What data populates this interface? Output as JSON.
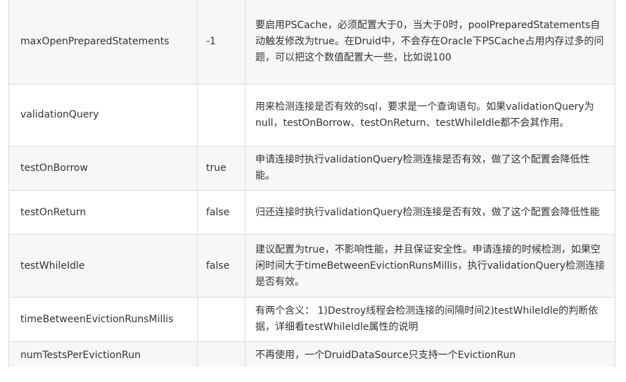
{
  "rows": [
    {
      "name": "maxOpenPreparedStatements",
      "default": "-1",
      "description": "要启用PSCache，必须配置大于0，当大于0时，poolPreparedStatements自动触发修改为true。在Druid中，不会存在Oracle下PSCache占用内存过多的问题，可以把这个数值配置大一些，比如说100"
    },
    {
      "name": "validationQuery",
      "default": "",
      "description": "用来检测连接是否有效的sql，要求是一个查询语句。如果validationQuery为null，testOnBorrow、testOnReturn、testWhileIdle都不会其作用。"
    },
    {
      "name": "testOnBorrow",
      "default": "true",
      "description": "申请连接时执行validationQuery检测连接是否有效，做了这个配置会降低性能。"
    },
    {
      "name": "testOnReturn",
      "default": "false",
      "description": "归还连接时执行validationQuery检测连接是否有效，做了这个配置会降低性能"
    },
    {
      "name": "testWhileIdle",
      "default": "false",
      "description": "建议配置为true，不影响性能，并且保证安全性。申请连接的时候检测，如果空闲时间大于timeBetweenEvictionRunsMillis，执行validationQuery检测连接是否有效。"
    },
    {
      "name": "timeBetweenEvictionRunsMillis",
      "default": "",
      "description": "有两个含义： 1)Destroy线程会检测连接的间隔时间2)testWhileIdle的判断依据，详细看testWhileIdle属性的说明"
    },
    {
      "name": "numTestsPerEvictionRun",
      "default": "",
      "description": "不再使用，一个DruidDataSource只支持一个EvictionRun"
    }
  ]
}
